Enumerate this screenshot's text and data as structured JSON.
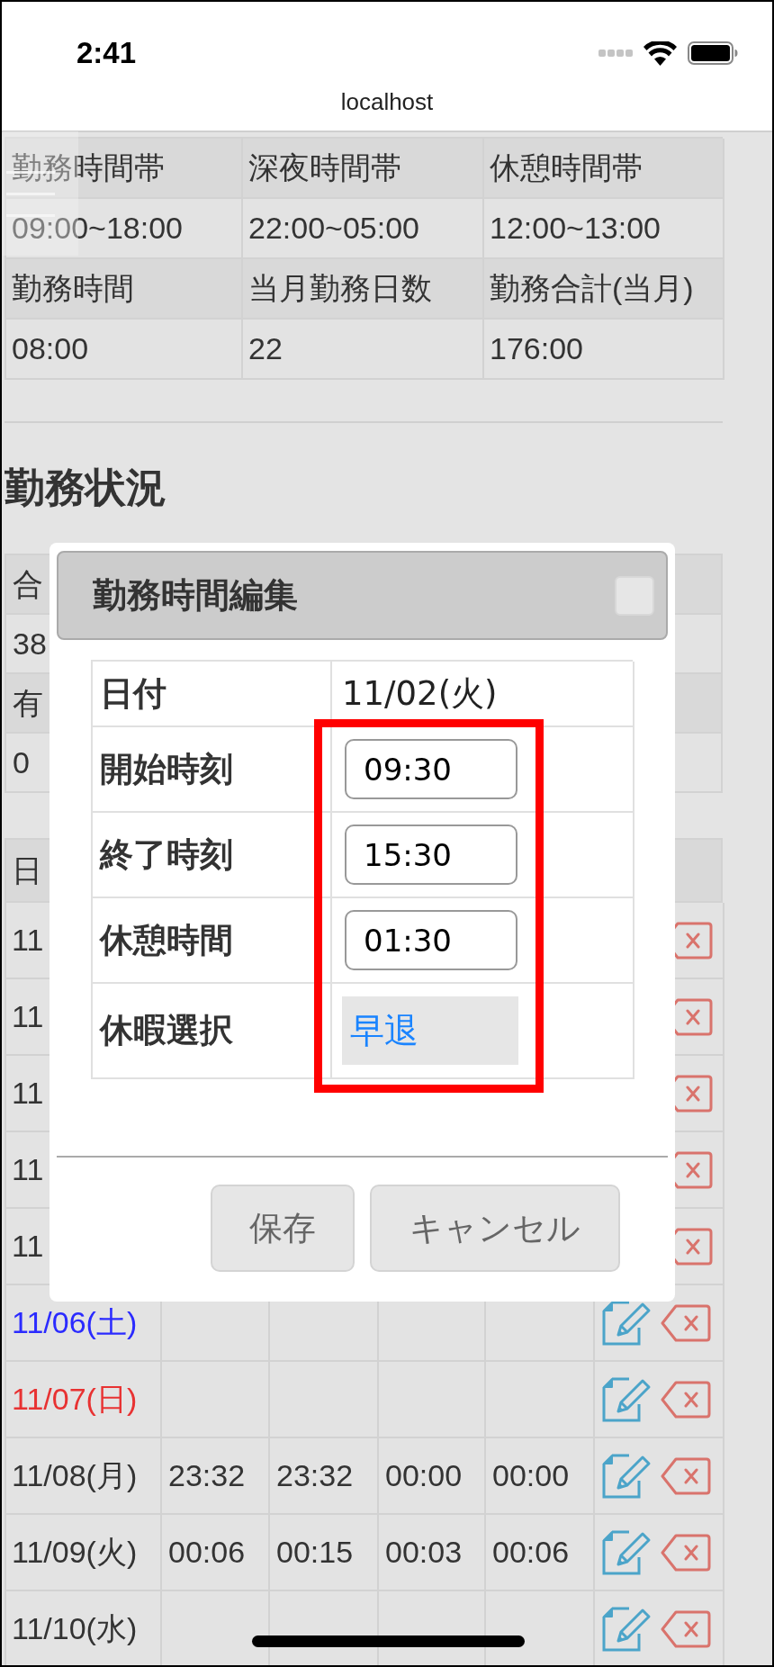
{
  "status_bar": {
    "time": "2:41",
    "url": "localhost"
  },
  "settings_table": {
    "rows": [
      {
        "kind": "header",
        "cells": [
          "勤務時間帯",
          "深夜時間帯",
          "休憩時間帯"
        ]
      },
      {
        "kind": "value",
        "cells": [
          "09:00~18:00",
          "22:00~05:00",
          "12:00~13:00"
        ]
      },
      {
        "kind": "header",
        "cells": [
          "勤務時間",
          "当月勤務日数",
          "勤務合計(当月)"
        ]
      },
      {
        "kind": "value",
        "cells": [
          "08:00",
          "22",
          "176:00"
        ]
      }
    ]
  },
  "section_title": "勤務状況",
  "summary_table": {
    "rows": [
      {
        "kind": "header",
        "text": "合"
      },
      {
        "kind": "value",
        "text": "38"
      },
      {
        "kind": "header",
        "text": "有"
      },
      {
        "kind": "value",
        "text": "0"
      }
    ]
  },
  "attendance_table": {
    "header": "日",
    "rows": [
      {
        "kind": "covered",
        "date": "11",
        "color": "#333333"
      },
      {
        "kind": "covered",
        "date": "11",
        "color": "#333333"
      },
      {
        "kind": "covered",
        "date": "11",
        "color": "#333333"
      },
      {
        "kind": "covered",
        "date": "11",
        "color": "#333333"
      },
      {
        "kind": "covered",
        "date": "11",
        "color": "#333333"
      },
      {
        "kind": "full",
        "date": "11/06(土)",
        "color": "#2b2bff"
      },
      {
        "kind": "full",
        "date": "11/07(日)",
        "color": "#e83232"
      },
      {
        "kind": "full",
        "date": "11/08(月)",
        "color": "#333333",
        "times": [
          "23:32",
          "23:32",
          "00:00",
          "00:00"
        ]
      },
      {
        "kind": "full",
        "date": "11/09(火)",
        "color": "#333333",
        "times": [
          "00:06",
          "00:15",
          "00:03",
          "00:06"
        ]
      },
      {
        "kind": "full",
        "date": "11/10(水)",
        "color": "#333333"
      }
    ]
  },
  "edit_dialog": {
    "title": "勤務時間編集",
    "highlighted": true,
    "fields": [
      {
        "kind": "text",
        "label": "日付",
        "value": "11/02(火)"
      },
      {
        "kind": "input",
        "label": "開始時刻",
        "value": "09:30"
      },
      {
        "kind": "input",
        "label": "終了時刻",
        "value": "15:30"
      },
      {
        "kind": "input",
        "label": "休憩時間",
        "value": "01:30"
      },
      {
        "kind": "select",
        "label": "休暇選択",
        "value": "早退"
      }
    ],
    "buttons": [
      "保存",
      "キャンセル"
    ]
  }
}
